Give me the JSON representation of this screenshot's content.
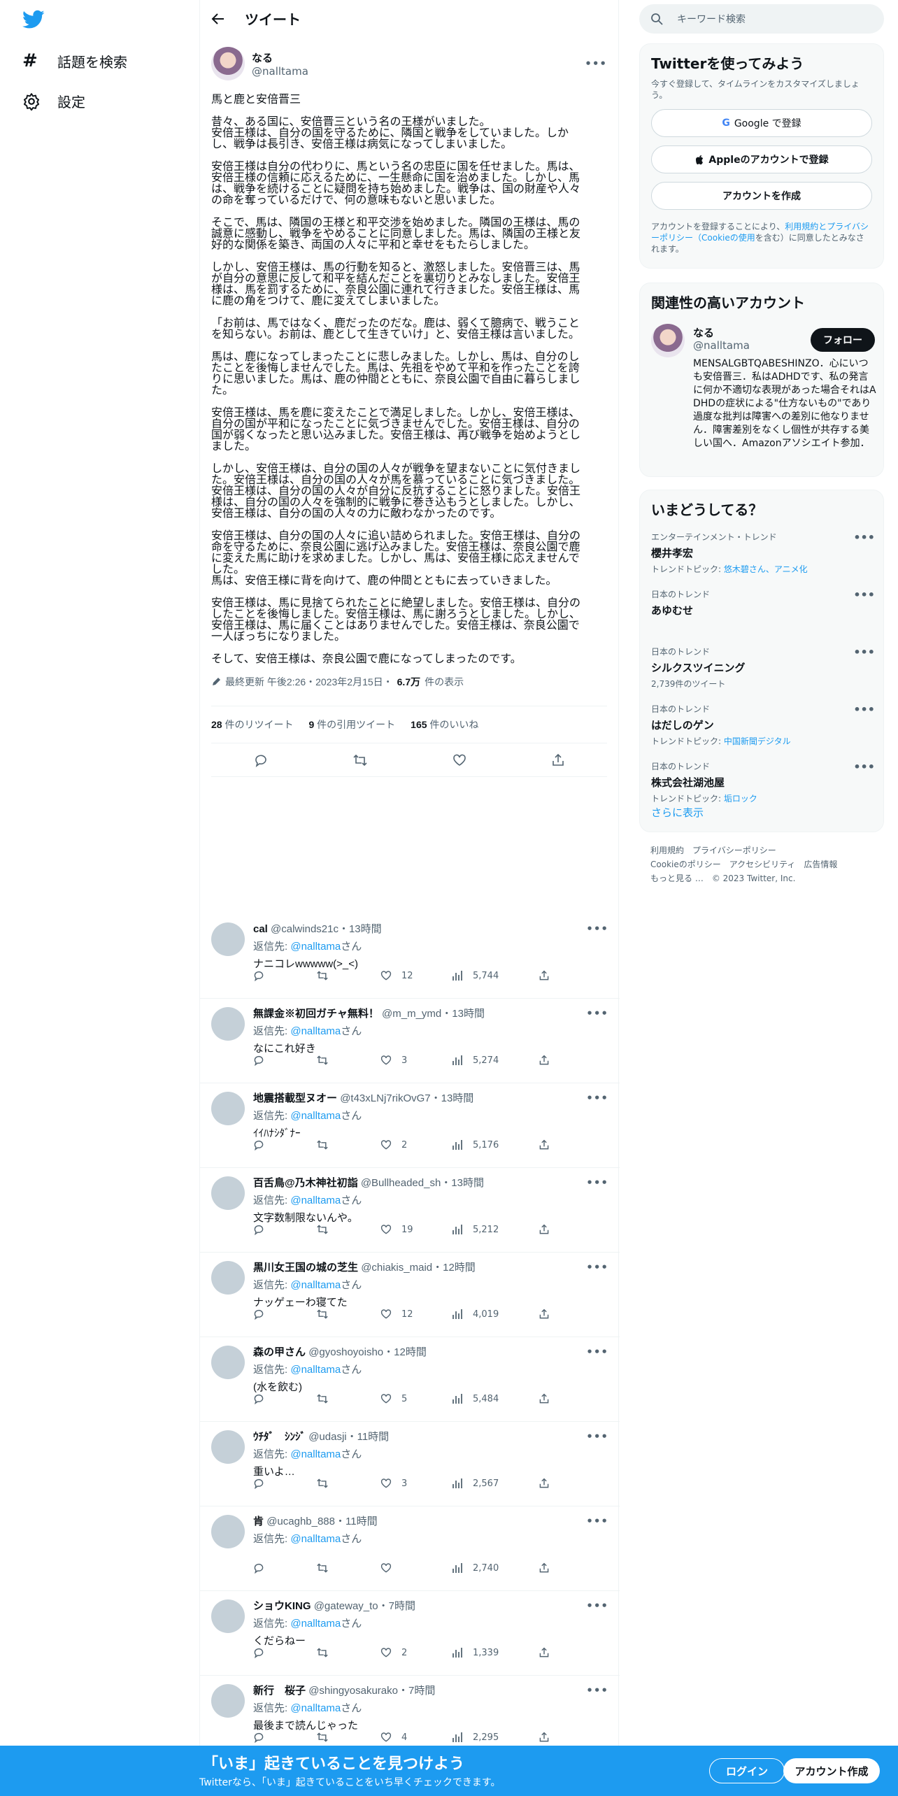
{
  "nav": {
    "explore_label": "話題を検索",
    "settings_label": "設定"
  },
  "header": {
    "title": "ツイート"
  },
  "tweet": {
    "author_name": "なる",
    "author_handle": "@nalltama",
    "body": "馬と鹿と安倍晋三\n\n昔々、ある国に、安倍晋三という名の王様がいました。\n安倍王様は、自分の国を守るために、隣国と戦争をしていました。しか\nし、戦争は長引き、安倍王様は病気になってしまいました。\n\n安倍王様は自分の代わりに、馬という名の忠臣に国を任せました。馬は、\n安倍王様の信頼に応えるために、一生懸命に国を治めました。しかし、馬\nは、戦争を続けることに疑問を持ち始めました。戦争は、国の財産や人々\nの命を奪っているだけで、何の意味もないと思いました。\n\nそこで、馬は、隣国の王様と和平交渉を始めました。隣国の王様は、馬の\n誠意に感動し、戦争をやめることに同意しました。馬は、隣国の王様と友\n好的な関係を築き、両国の人々に平和と幸せをもたらしました。\n\nしかし、安倍王様は、馬の行動を知ると、激怒しました。安倍晋三は、馬\nが自分の意思に反して和平を結んだことを裏切りとみなしました。安倍王\n様は、馬を罰するために、奈良公園に連れて行きました。安倍王様は、馬\nに鹿の角をつけて、鹿に変えてしまいました。\n\n「お前は、馬ではなく、鹿だったのだな。鹿は、弱くて臆病で、戦うこと\nを知らない。お前は、鹿として生きていけ」と、安倍王様は言いました。\n\n馬は、鹿になってしまったことに悲しみました。しかし、馬は、自分のし\nたことを後悔しませんでした。馬は、先祖をやめて平和を作ったことを誇\nりに思いました。馬は、鹿の仲間とともに、奈良公園で自由に暮らしまし\nた。\n\n安倍王様は、馬を鹿に変えたことで満足しました。しかし、安倍王様は、\n自分の国が平和になったことに気づきませんでした。安倍王様は、自分の\n国が弱くなったと思い込みました。安倍王様は、再び戦争を始めようとし\nました。\n\nしかし、安倍王様は、自分の国の人々が戦争を望まないことに気付きまし\nた。安倍王様は、自分の国の人々が馬を慕っていることに気づきました。\n安倍王様は、自分の国の人々が自分に反抗することに怒りました。安倍王\n様は、自分の国の人々を強制的に戦争に巻き込もうとしました。しかし、\n安倍王様は、自分の国の人々の力に敵わなかったのです。\n\n安倍王様は、自分の国の人々に追い詰められました。安倍王様は、自分の\n命を守るために、奈良公園に逃げ込みました。安倍王様は、奈良公園で鹿\nに変えた馬に助けを求めました。しかし、馬は、安倍王様に応えませんで\nした。\n馬は、安倍王様に背を向けて、鹿の仲間とともに去っていきました。\n\n安倍王様は、馬に見捨てられたことに絶望しました。安倍王様は、自分の\nしたことを後悔しました。安倍王様は、馬に謝ろうとしました。しかし、\n安倍王様は、馬に届くことはありませんでした。安倍王様は、奈良公園で\n一人ぼっちになりました。\n\nそして、安倍王様は、奈良公園で鹿になってしまったのです。",
    "edited_prefix": "最終更新 午後2:26・2023年2月15日・",
    "views_count": "6.7万",
    "views_label": "件の表示",
    "retweets_count": "28",
    "retweets_label": "件のリツイート",
    "quotes_count": "9",
    "quotes_label": "件の引用ツイート",
    "likes_count": "165",
    "likes_label": "件のいいね"
  },
  "reply_to_label": "返信先:",
  "reply_to_handle": "@nalltama",
  "reply_to_suffix": "さん",
  "replies": [
    {
      "name": "cal",
      "handle": "@calwinds21c",
      "time": "・13時間",
      "text": "ナニコレwwwww(>_<)",
      "likes": "12",
      "views": "5,744"
    },
    {
      "name": "無課金※初回ガチャ無料！",
      "handle": "@m_m_ymd",
      "time": "・13時間",
      "text": "なにこれ好き",
      "likes": "3",
      "views": "5,274"
    },
    {
      "name": "地震搭載型ヌオー",
      "handle": "@t43xLNj7rikOvG7",
      "time": "・13時間",
      "text": "ｲｲﾊﾅｼﾀﾞﾅｰ",
      "likes": "2",
      "views": "5,176"
    },
    {
      "name": "百舌鳥@乃木神社初詣",
      "handle": "@Bullheaded_sh",
      "time": "・13時間",
      "text": "文字数制限ないんや。",
      "likes": "19",
      "views": "5,212"
    },
    {
      "name": "黒川女王国の城の芝生",
      "handle": "@chiakis_maid",
      "time": "・12時間",
      "text": "ナッゲェーわ寝てた",
      "likes": "12",
      "views": "4,019"
    },
    {
      "name": "森の甲さん",
      "handle": "@gyoshoyoisho",
      "time": "・12時間",
      "text": "(水を飲む)",
      "likes": "5",
      "views": "5,484"
    },
    {
      "name": "ｳﾁﾀﾞ　ｼﾝｼﾞ",
      "handle": "@udasji",
      "time": "・11時間",
      "text": "重いよ…",
      "likes": "3",
      "views": "2,567"
    },
    {
      "name": "肯",
      "handle": "@ucaghb_888",
      "time": "・11時間",
      "text": "",
      "likes": "",
      "views": "2,740"
    },
    {
      "name": "ショウKING",
      "handle": "@gateway_to",
      "time": "・7時間",
      "text": "くだらねー",
      "likes": "2",
      "views": "1,339"
    },
    {
      "name": "新行　桜子",
      "handle": "@shingyosakurako",
      "time": "・7時間",
      "text": "最後まで読んじゃった",
      "likes": "4",
      "views": "2,295"
    }
  ],
  "sidebar": {
    "search_placeholder": "キーワード検索",
    "signup": {
      "title": "Twitterを使ってみよう",
      "subtitle": "今すぐ登録して、タイムラインをカスタマイズしましょう。",
      "google_label": "Google で登録",
      "apple_label": "Appleのアカウントで登録",
      "create_label": "アカウントを作成",
      "terms_prefix": "アカウントを登録することにより、",
      "terms_link": "利用規約とプライバシーポリシー（Cookieの使用",
      "terms_suffix": "を含む）に同意したとみなされます。"
    },
    "related": {
      "title": "関連性の高いアカウント",
      "name": "なる",
      "handle": "@nalltama",
      "follow_label": "フォロー",
      "bio": "MENSALGBTQABESHINZO．心にいつも安倍晋三．私はADHDです、私の発言に何か不適切な表現があった場合それはADHDの症状による\"仕方ないもの\"であり過度な批判は障害への差別に他なりません．障害差別をなくし個性が共存する美しい国へ．Amazonアソシエイト参加．"
    },
    "trends": {
      "title": "いまどうしてる？",
      "items": [
        {
          "category": "エンターテインメント・トレンド",
          "name": "櫻井孝宏",
          "sub_prefix": "トレンドトピック: ",
          "sub_link": "悠木碧さん、アニメ化"
        },
        {
          "category": "日本のトレンド",
          "name": "あゆむせ",
          "sub_prefix": "",
          "sub_link": ""
        },
        {
          "category": "日本のトレンド",
          "name": "シルクスツイニング",
          "sub_prefix": "2,739件のツイート",
          "sub_link": ""
        },
        {
          "category": "日本のトレンド",
          "name": "はだしのゲン",
          "sub_prefix": "トレンドトピック: ",
          "sub_link": "中国新聞デジタル"
        },
        {
          "category": "日本のトレンド",
          "name": "株式会社湖池屋",
          "sub_prefix": "トレンドトピック: ",
          "sub_link": "垢ロック"
        }
      ],
      "show_more": "さらに表示"
    },
    "footer": {
      "terms": "利用規約",
      "privacy": "プライバシーポリシー",
      "cookie": "Cookieのポリシー",
      "accessibility": "アクセシビリティ",
      "ads": "広告情報",
      "more": "もっと見る …",
      "copyright": "© 2023 Twitter, Inc."
    }
  },
  "banner": {
    "title": "「いま」起きていることを見つけよう",
    "subtitle": "Twitterなら、「いま」起きていることをいち早くチェックできます。",
    "login": "ログイン",
    "signup": "アカウント作成"
  },
  "colors": {
    "brand": "#1d9bf0",
    "text": "#0f1419",
    "secondary": "#536471"
  }
}
